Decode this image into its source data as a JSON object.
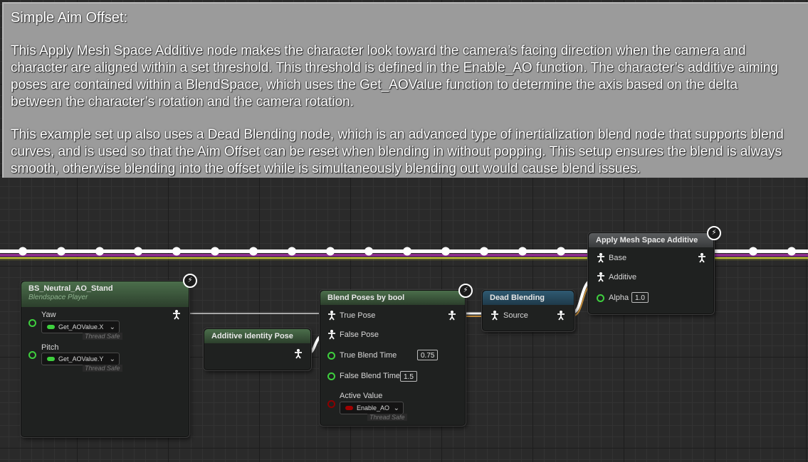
{
  "comment": {
    "title": "Simple Aim Offset:",
    "paragraph1": "This Apply Mesh Space Additive node makes the character look toward the camera’s facing direction when the camera and\ncharacter are aligned within a set threshold. This threshold is defined in the Enable_AO function. The character’s additive aiming\nposes are contained within a BlendSpace, which uses the Get_AOValue function to determine the axis based on the delta\nbetween the character’s rotation and the camera rotation.",
    "paragraph2": "This example set up also uses a Dead Blending node, which is an advanced type of inertialization blend node that supports blend\ncurves, and is used so that the Aim Offset can be reset when blending in without popping. This setup ensures the blend is always\nsmooth, otherwise blending into the offset while is simultaneously blending out would cause blend issues."
  },
  "nodes": {
    "blendspace": {
      "title": "BS_Neutral_AO_Stand",
      "subtitle": "Blendspace Player",
      "yaw_label": "Yaw",
      "yaw_value": "Get_AOValue.X",
      "pitch_label": "Pitch",
      "pitch_value": "Get_AOValue.Y",
      "thread_safe": "Thread Safe"
    },
    "additive_identity": {
      "title": "Additive Identity Pose"
    },
    "blend_by_bool": {
      "title": "Blend Poses by bool",
      "true_pose": "True Pose",
      "false_pose": "False Pose",
      "true_blend_time_label": "True Blend Time",
      "true_blend_time": "0.75",
      "false_blend_time_label": "False Blend Time",
      "false_blend_time": "1.5",
      "active_value_label": "Active Value",
      "active_value": "Enable_AO",
      "thread_safe": "Thread Safe"
    },
    "dead_blending": {
      "title": "Dead Blending",
      "source": "Source"
    },
    "apply_mesh_space": {
      "title": "Apply Mesh Space Additive",
      "base": "Base",
      "additive": "Additive",
      "alpha_label": "Alpha",
      "alpha": "1.0"
    }
  },
  "colors": {
    "float_pin": "#3ecf3e",
    "bool_pin": "#8b0000",
    "wire_white": "#ffffff",
    "wire_purple": "#8a2d8a",
    "wire_yellow": "#d2d23c"
  }
}
